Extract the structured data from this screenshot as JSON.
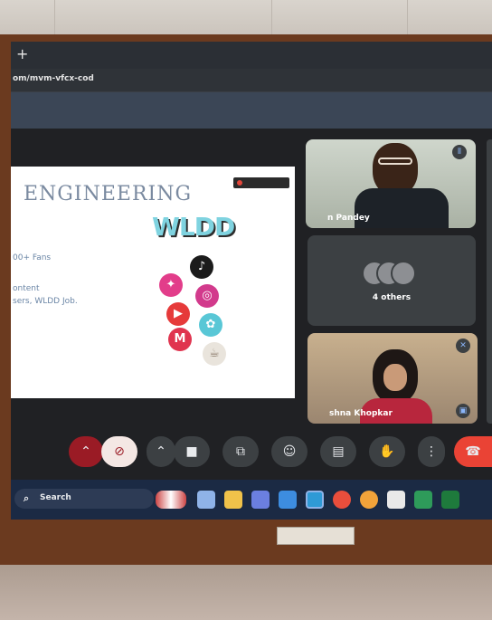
{
  "browser": {
    "new_tab_symbol": "+",
    "url": "om/mvm-vfcx-cod"
  },
  "presentation": {
    "title": "ENGINEERING",
    "brand": "WLDD",
    "line1": "00+ Fans",
    "line2": "ontent",
    "line3": "sers, WLDD Job.",
    "social_icons": [
      "tiktok-icon",
      "instagram-icon",
      "youtube-icon",
      "moj-icon",
      "chingari-icon",
      "gmail-icon"
    ]
  },
  "participants": {
    "speaker_name": "n Pandey",
    "others_label": "4 others",
    "third_name": "shna Khopkar"
  },
  "controls": {
    "items": [
      "chevron-up-icon",
      "mic-off-icon",
      "chevron-up-icon",
      "camera-icon",
      "present-icon",
      "emoji-icon",
      "captions-icon",
      "raise-hand-icon",
      "more-icon",
      "end-call-icon"
    ]
  },
  "taskbar": {
    "search_label": "Search"
  },
  "colors": {
    "end_call": "#ea4335",
    "mic_muted_bg": "#9a1b25",
    "taskbar": "#1b2a44",
    "frame": "#6b3a1f"
  }
}
